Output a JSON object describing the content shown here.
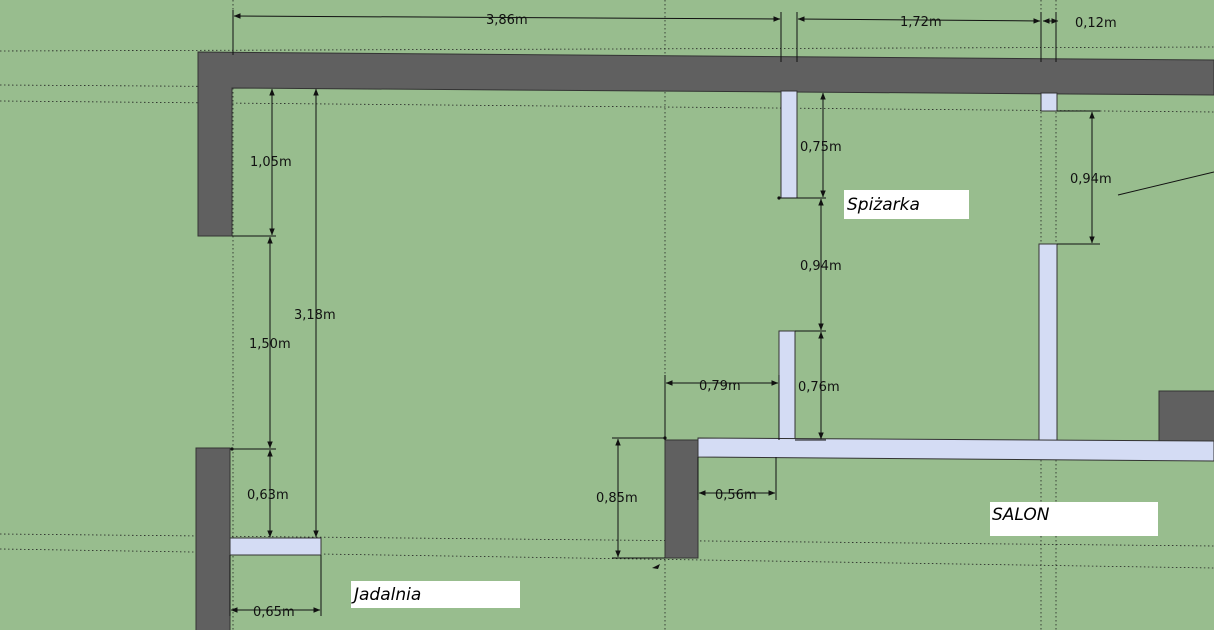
{
  "colors": {
    "background": "#98bd8e",
    "wall": "#606060",
    "partition": "#d4dcf4",
    "label_bg": "#ffffff",
    "line": "#111111"
  },
  "rooms": {
    "spizarka": "Spiżarka",
    "jadalnia": "Jadalnia",
    "salon": "SALON"
  },
  "dimensions": {
    "top_width": "3,86m",
    "pantry_span": "1,72m",
    "small_gap": "0,12m",
    "left_upper_wall": "1,05m",
    "left_opening": "1,50m",
    "left_total": "3,18m",
    "left_lower": "0,63m",
    "bottom_left_stub": "0,65m",
    "pantry_wall_upper": "0,75m",
    "pantry_door": "0,94m",
    "pantry_wall_lower": "0,76m",
    "right_door": "0,94m",
    "mid_gap": "0,79m",
    "mid_offset": "0,56m",
    "mid_wall": "0,85m"
  }
}
